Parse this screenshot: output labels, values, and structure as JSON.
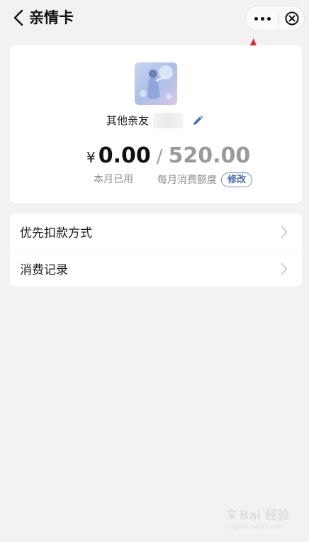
{
  "nav": {
    "title": "亲情卡"
  },
  "card": {
    "relation": "其他亲友",
    "currency": "¥",
    "used_amount": "0.00",
    "separator": "/",
    "monthly_limit": "520.00",
    "used_label": "本月已用",
    "limit_label": "每月消费额度",
    "modify_label": "修改"
  },
  "list": {
    "items": [
      {
        "label": "优先扣款方式"
      },
      {
        "label": "消费记录"
      }
    ]
  },
  "watermark": {
    "brand": "Bai 经验",
    "url": "jingyan.baidu.com"
  },
  "colors": {
    "background": "#f2f2f2",
    "card": "#ffffff",
    "accent_blue": "#3d6fd6",
    "annotation_red": "#e8262a",
    "muted_text": "#8a8a8a"
  },
  "icons": [
    "chevron-left-icon",
    "more-icon",
    "close-circle-icon",
    "pencil-icon",
    "chevron-right-icon",
    "red-arrow-annotation"
  ]
}
